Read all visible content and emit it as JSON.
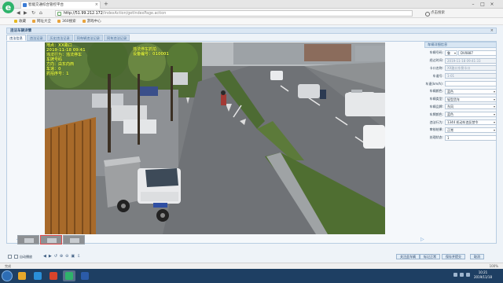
{
  "browser": {
    "tab_title": "智能交通综合管控平台",
    "url_host": "http://51.99.212.172",
    "url_path": "/IndexAction/getIndexPage.action",
    "right_search": "点击搜索",
    "logo": "e",
    "favorites": [
      "收藏",
      "网址大全",
      "360搜索",
      "游戏中心"
    ]
  },
  "app": {
    "header_title": "违法车辆详情",
    "close": "×",
    "tabs": [
      "违法信息",
      "违法记录",
      "历史违法记录",
      "同车辆违法记录",
      "同车违法记录"
    ]
  },
  "video_overlay": {
    "lines_left": [
      "地点：XX路口",
      "2019-11-18 09:41",
      "违法行为：违法停车",
      "车牌号码",
      "方向：由东向西",
      "车速：0",
      "抓拍序号：1"
    ],
    "lines_right": [
      "违法停车抓拍",
      "设备编号：010001"
    ]
  },
  "form": {
    "title": "车辆详细信息",
    "fields": [
      {
        "label": "车辆号码:",
        "value": "鲁",
        "extra": "DV0887",
        "type": "plate"
      },
      {
        "label": "经过时间:",
        "value": "2019-11-18 09:41:33",
        "type": "ro"
      },
      {
        "label": "卡口名称:",
        "value": "XX路口东侧卡口",
        "type": "ro"
      },
      {
        "label": "车道号:",
        "value": "1-01",
        "type": "ro"
      },
      {
        "label": "车速(km/h):",
        "value": "",
        "type": "text"
      },
      {
        "label": "车辆颜色:",
        "value": "蓝色",
        "type": "sel"
      },
      {
        "label": "车辆类型:",
        "value": "轻型货车",
        "type": "sel"
      },
      {
        "label": "车辆品牌:",
        "value": "东风",
        "type": "sel"
      },
      {
        "label": "车牌颜色:",
        "value": "蓝色",
        "type": "sel"
      },
      {
        "label": "违法行为:",
        "value": "1344 机动车违反禁令",
        "type": "sel"
      },
      {
        "label": "审核结果:",
        "value": "正常",
        "type": "sel"
      },
      {
        "label": "处理状态:",
        "value": "1",
        "type": "text"
      }
    ]
  },
  "toolbar": {
    "autoplay_label": "自动播放",
    "buttons": [
      "关注此车辆",
      "标记正常",
      "保存并提交",
      "取消"
    ]
  },
  "status": {
    "left": "完成",
    "right": "100%"
  },
  "taskbar": {
    "time": "10:21",
    "date": "2019/11/18"
  },
  "colors": {
    "app_bg": "#eef3f8",
    "accent": "#3b638d",
    "overlay_text": "#d7ef3c",
    "taskbar": "#1e3f63"
  }
}
